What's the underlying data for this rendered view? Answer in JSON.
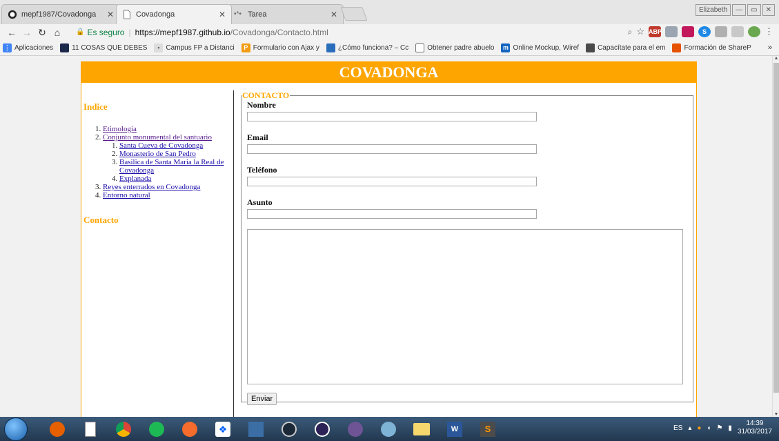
{
  "window": {
    "user_badge": "Elizabeth",
    "controls": [
      "—",
      "▭",
      "✕"
    ]
  },
  "tabs": [
    {
      "label": "mepf1987/Covadonga",
      "icon": "github-icon",
      "active": false
    },
    {
      "label": "Covadonga",
      "icon": "page-icon",
      "active": true
    },
    {
      "label": "Tarea",
      "icon": "campus-icon",
      "active": false
    }
  ],
  "toolbar": {
    "secure_label": "Es seguro",
    "url_host": "https://mepf1987.github.io",
    "url_path": "/Covadonga/Contacto.html"
  },
  "extensions": [
    {
      "label": "ABP",
      "color": "#c0392b"
    },
    {
      "label": "",
      "color": "#9aa5b1"
    },
    {
      "label": "",
      "color": "#c2185b"
    },
    {
      "label": "S",
      "color": "#1e88e5"
    },
    {
      "label": "",
      "color": "#b0b0b0"
    },
    {
      "label": "",
      "color": "#c8c8c8"
    },
    {
      "label": "",
      "color": "#6aa84f"
    }
  ],
  "bookmarks": [
    {
      "label": "Aplicaciones",
      "icon_color": "#4285f4"
    },
    {
      "label": "11 COSAS QUE DEBES",
      "icon_color": "#1b2a4a"
    },
    {
      "label": "Campus FP a Distanci",
      "icon_color": "#888888"
    },
    {
      "label": "Formulario con Ajax y",
      "icon_color": "#f39c12"
    },
    {
      "label": "¿Cómo funciona? – Cc",
      "icon_color": "#2a6ebb"
    },
    {
      "label": "Obtener padre abuelo",
      "icon_color": "#777777"
    },
    {
      "label": "Online Mockup, Wiref",
      "icon_color": "#1565c0"
    },
    {
      "label": "Capacítate para el em",
      "icon_color": "#4a4a4a"
    },
    {
      "label": "Formación de ShareP",
      "icon_color": "#e65100"
    }
  ],
  "bookmarks_more": "»",
  "page": {
    "banner_title": "COVADONGA",
    "sidebar": {
      "index_heading": "Indice",
      "items": [
        {
          "label": "Etimologia",
          "visited": true
        },
        {
          "label": "Conjunto monumental del santuario",
          "visited": true
        },
        {
          "label": "Reyes enterrados en Covadonga",
          "visited": false
        },
        {
          "label": "Entorno natural",
          "visited": false
        }
      ],
      "subitems": [
        {
          "label": "Santa Cueva de Covadonga",
          "visited": false
        },
        {
          "label": "Monasterio de San Pedro",
          "visited": false
        },
        {
          "label": "Basilica de Santa Maria la Real de Covadonga",
          "visited": false
        },
        {
          "label": "Explanada",
          "visited": false
        }
      ],
      "contact_heading": "Contacto"
    },
    "form": {
      "legend": "CONTACTO",
      "fields": [
        {
          "label": "Nombre",
          "value": ""
        },
        {
          "label": "Email",
          "value": ""
        },
        {
          "label": "Teléfono",
          "value": ""
        },
        {
          "label": "Asunto",
          "value": ""
        }
      ],
      "message_value": "",
      "submit_label": "Enviar"
    }
  },
  "taskbar": {
    "apps": [
      {
        "name": "firefox-icon",
        "color": "#e66000"
      },
      {
        "name": "notepad-icon",
        "color": "#ffffff"
      },
      {
        "name": "chrome-icon",
        "color": "#db4437"
      },
      {
        "name": "spotify-icon",
        "color": "#1db954"
      },
      {
        "name": "origin-icon",
        "color": "#f56c2d"
      },
      {
        "name": "dropbox-icon",
        "color": "#0061ff"
      },
      {
        "name": "visual-studio-icon",
        "color": "#3a6ea5"
      },
      {
        "name": "steam-icon",
        "color": "#1b2838"
      },
      {
        "name": "eclipse-icon",
        "color": "#2c2255"
      },
      {
        "name": "github-desktop-icon",
        "color": "#6e5494"
      },
      {
        "name": "paint-icon",
        "color": "#7fb3d5"
      },
      {
        "name": "explorer-icon",
        "color": "#f5d76e"
      },
      {
        "name": "word-icon",
        "color": "#2b579a"
      },
      {
        "name": "sublime-icon",
        "color": "#4b4b4b"
      }
    ],
    "language": "ES",
    "time": "14:39",
    "date": "31/03/2017"
  }
}
